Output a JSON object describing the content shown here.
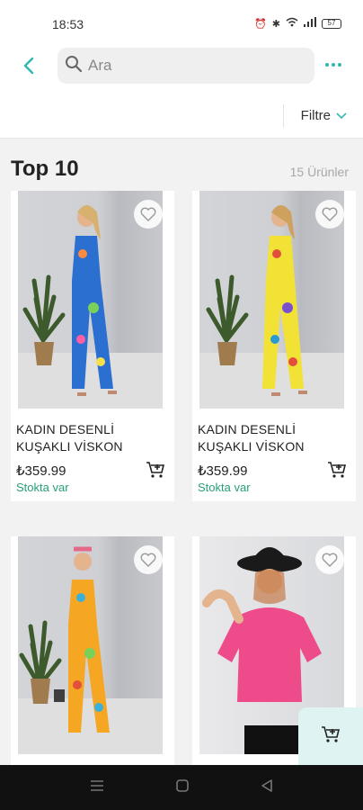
{
  "status_bar": {
    "time": "18:53",
    "battery": "57"
  },
  "search": {
    "placeholder": "Ara"
  },
  "filter": {
    "label": "Filtre"
  },
  "section": {
    "title": "Top 10",
    "count": "15 Ürünler"
  },
  "products": [
    {
      "name_line1": "KADIN DESENLİ",
      "name_line2": "KUŞAKLI VİSKON",
      "price": "₺359.99",
      "stock": "Stokta var"
    },
    {
      "name_line1": "KADIN DESENLİ",
      "name_line2": "KUŞAKLI VİSKON",
      "price": "₺359.99",
      "stock": "Stokta var"
    }
  ],
  "colors": {
    "accent": "#2fb8b2",
    "stock_green": "#27a07a"
  }
}
